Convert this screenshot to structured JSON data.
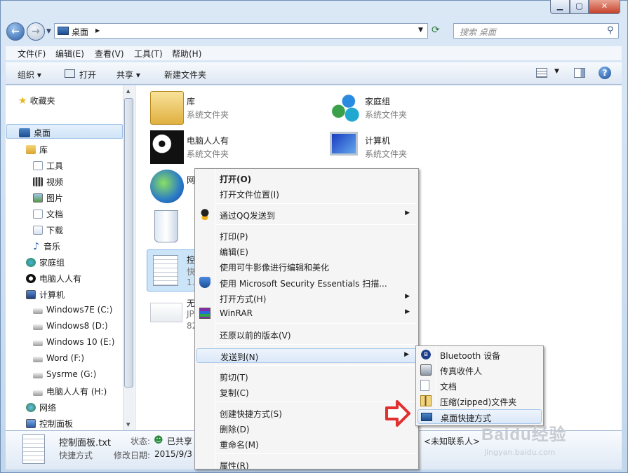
{
  "titlebar": {
    "min": "▁",
    "max": "▢",
    "close": "✕"
  },
  "address": {
    "location": "桌面",
    "separator": "▶"
  },
  "search": {
    "placeholder": "搜索 桌面"
  },
  "menubar": [
    "文件(F)",
    "编辑(E)",
    "查看(V)",
    "工具(T)",
    "帮助(H)"
  ],
  "commandbar": {
    "organize": "组织 ▾",
    "open": "打开",
    "share": "共享 ▾",
    "new_folder": "新建文件夹"
  },
  "nav": {
    "favorites": "收藏夹",
    "desktop": "桌面",
    "libraries": "库",
    "tools": "工具",
    "videos": "视频",
    "pictures": "图片",
    "documents": "文档",
    "downloads": "下载",
    "music": "音乐",
    "homegroup": "家庭组",
    "pcuser": "电脑人人有",
    "computer": "计算机",
    "drives": [
      "Windows7E (C:)",
      "Windows8 (D:)",
      "Windows 10 (E:)",
      "Word (F:)",
      "Sysrme (G:)",
      "电脑人人有 (H:)"
    ],
    "network": "网络",
    "controlpanel": "控制面板"
  },
  "files": {
    "library": {
      "name": "库",
      "type": "系统文件夹"
    },
    "homegroup": {
      "name": "家庭组",
      "type": "系统文件夹"
    },
    "pcuser": {
      "name": "电脑人人有",
      "type": "系统文件夹"
    },
    "computer": {
      "name": "计算机",
      "type": "系统文件夹"
    },
    "network": {
      "name": "网"
    },
    "recycle": {},
    "controlpanel": {
      "name": "控",
      "line2": "快",
      "line3": "1."
    },
    "untitled": {
      "name": "无",
      "line2": "JP",
      "line3": "82"
    }
  },
  "details": {
    "filename": "控制面板.txt",
    "type": "快捷方式",
    "status_label": "状态:",
    "status_value": "已共享",
    "modified_label": "修改日期:",
    "modified_value": "2015/9/3",
    "contact": "<未知联系人>"
  },
  "context_menu": {
    "open": "打开(O)",
    "open_location": "打开文件位置(I)",
    "send_qq": "通过QQ发送到",
    "print": "打印(P)",
    "edit": "编辑(E)",
    "edit_kn": "使用可牛影像进行编辑和美化",
    "mse": "使用 Microsoft Security Essentials 扫描...",
    "open_with": "打开方式(H)",
    "winrar": "WinRAR",
    "restore": "还原以前的版本(V)",
    "send_to": "发送到(N)",
    "cut": "剪切(T)",
    "copy": "复制(C)",
    "create_shortcut": "创建快捷方式(S)",
    "delete": "删除(D)",
    "rename": "重命名(M)",
    "properties": "属性(R)",
    "submenu_arrow": "▶"
  },
  "send_to_menu": {
    "bluetooth": "Bluetooth 设备",
    "fax": "传真收件人",
    "documents": "文档",
    "zip": "压缩(zipped)文件夹",
    "desktop_shortcut": "桌面快捷方式"
  },
  "watermark": {
    "brand": "Baidu经验",
    "url": "jingyan.baidu.com"
  },
  "colors": {
    "accent": "#2a5fa6",
    "highlight": "#cce4f7",
    "arrow": "#e03030"
  }
}
